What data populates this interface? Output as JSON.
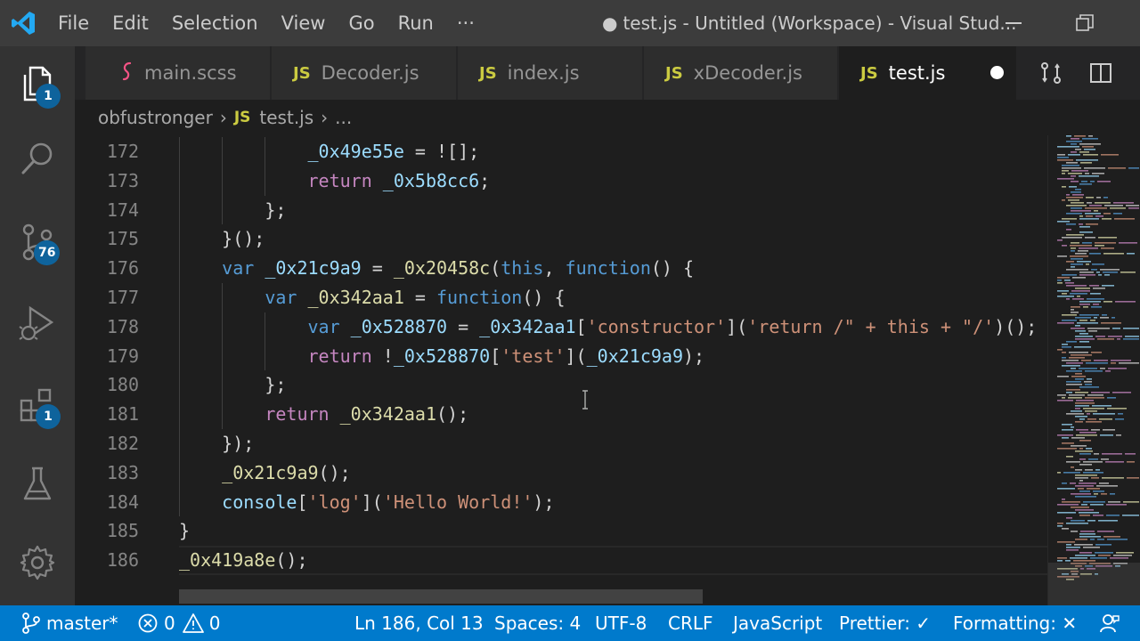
{
  "titlebar": {
    "menu": [
      "File",
      "Edit",
      "Selection",
      "View",
      "Go",
      "Run",
      "···"
    ],
    "window_title": "test.js - Untitled (Workspace) - Visual Stud...",
    "dirty_dot": "●"
  },
  "activitybar": {
    "explorer_badge": "1",
    "source_control_badge": "76",
    "extensions_badge": "1"
  },
  "tabs": [
    {
      "label": "main.scss",
      "icon": "sass-icon",
      "icon_text": ""
    },
    {
      "label": "Decoder.js",
      "icon": "js-icon",
      "icon_text": "JS"
    },
    {
      "label": "index.js",
      "icon": "js-icon",
      "icon_text": "JS"
    },
    {
      "label": "xDecoder.js",
      "icon": "js-icon",
      "icon_text": "JS"
    },
    {
      "label": "test.js",
      "icon": "js-icon",
      "icon_text": "JS",
      "active": true,
      "dirty": true
    }
  ],
  "breadcrumb": {
    "folder": "obfustronger",
    "file_icon": "JS",
    "file": "test.js",
    "more": "..."
  },
  "editor": {
    "line_numbers": [
      "172",
      "173",
      "174",
      "175",
      "176",
      "177",
      "178",
      "179",
      "180",
      "181",
      "182",
      "183",
      "184",
      "185",
      "186"
    ]
  },
  "statusbar": {
    "branch": "master*",
    "errors": "0",
    "warnings": "0",
    "position": "Ln 186, Col 13",
    "spaces": "Spaces: 4",
    "encoding": "UTF-8",
    "eol": "CRLF",
    "language": "JavaScript",
    "prettier": "Prettier: ✓",
    "formatting": "Formatting: ✕"
  },
  "colors": {
    "statusbar": "#007acc",
    "titlebar": "#3c3c3c",
    "activitybar": "#333333",
    "editor_bg": "#1e1e1e",
    "badge": "#0e639c",
    "js_icon": "#cbcb41"
  }
}
